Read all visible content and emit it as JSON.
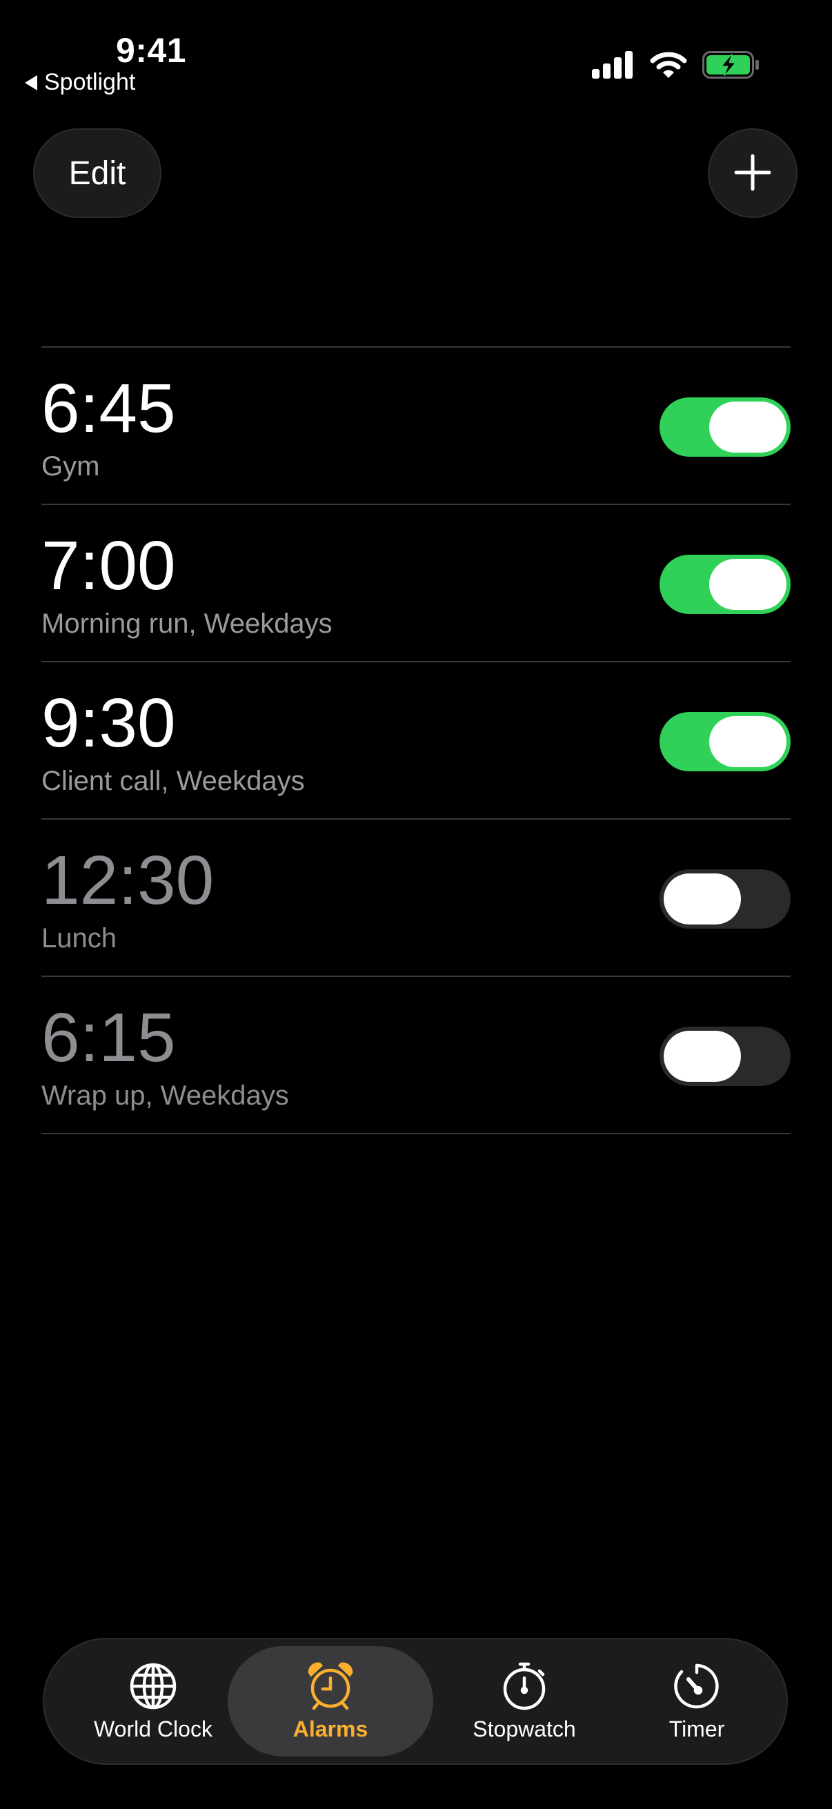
{
  "status_bar": {
    "time": "9:41",
    "back_label": "Spotlight"
  },
  "header": {
    "edit_label": "Edit"
  },
  "alarms": [
    {
      "time": "6:45",
      "label": "Gym",
      "enabled": true
    },
    {
      "time": "7:00",
      "label": "Morning run, Weekdays",
      "enabled": true
    },
    {
      "time": "9:30",
      "label": "Client call, Weekdays",
      "enabled": true
    },
    {
      "time": "12:30",
      "label": "Lunch",
      "enabled": false
    },
    {
      "time": "6:15",
      "label": "Wrap up, Weekdays",
      "enabled": false
    }
  ],
  "tabs": [
    {
      "label": "World Clock",
      "icon": "globe-icon",
      "active": false
    },
    {
      "label": "Alarms",
      "icon": "alarm-clock-icon",
      "active": true
    },
    {
      "label": "Stopwatch",
      "icon": "stopwatch-icon",
      "active": false
    },
    {
      "label": "Timer",
      "icon": "timer-icon",
      "active": false
    }
  ],
  "colors": {
    "toggle_on": "#30d158",
    "active_tab": "#fab02f",
    "background": "#000000"
  }
}
